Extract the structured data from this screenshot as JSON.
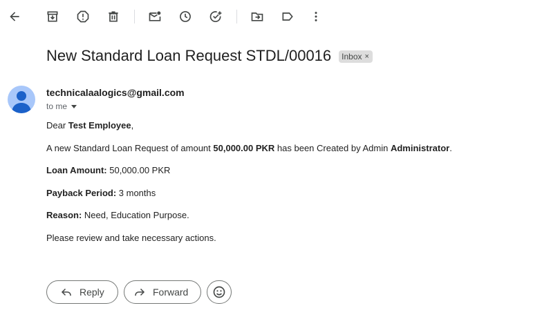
{
  "toolbar": {
    "back": "back-arrow-icon",
    "archive": "archive-icon",
    "spam": "report-spam-icon",
    "delete": "delete-icon",
    "mark_unread": "mark-unread-icon",
    "snooze": "snooze-icon",
    "add_task": "add-task-icon",
    "move_to": "move-to-icon",
    "labels": "label-icon",
    "more": "more-vert-icon"
  },
  "email": {
    "subject": "New Standard Loan Request STDL/00016",
    "label_chip": "Inbox",
    "label_chip_close": "×",
    "sender": "technicalaalogics@gmail.com",
    "recipients": "to me",
    "body": {
      "greeting_prefix": "Dear ",
      "greeting_name": "Test Employee",
      "greeting_suffix": ",",
      "intro_prefix": "A new Standard Loan Request of amount ",
      "intro_amount": "50,000.00 PKR",
      "intro_middle": " has been Created by Admin ",
      "intro_admin": "Administrator",
      "intro_suffix": ".",
      "loan_amount_label": "Loan Amount:",
      "loan_amount_value": " 50,000.00 PKR",
      "payback_label": "Payback Period:",
      "payback_value": " 3 months",
      "reason_label": "Reason:",
      "reason_value": " Need, Education Purpose.",
      "closing": "Please review and take necessary actions."
    }
  },
  "actions": {
    "reply_label": "Reply",
    "forward_label": "Forward"
  },
  "colors": {
    "avatar_bg": "#a8c7fa",
    "avatar_fg": "#1b61c9",
    "chip_bg": "#dddddd"
  }
}
